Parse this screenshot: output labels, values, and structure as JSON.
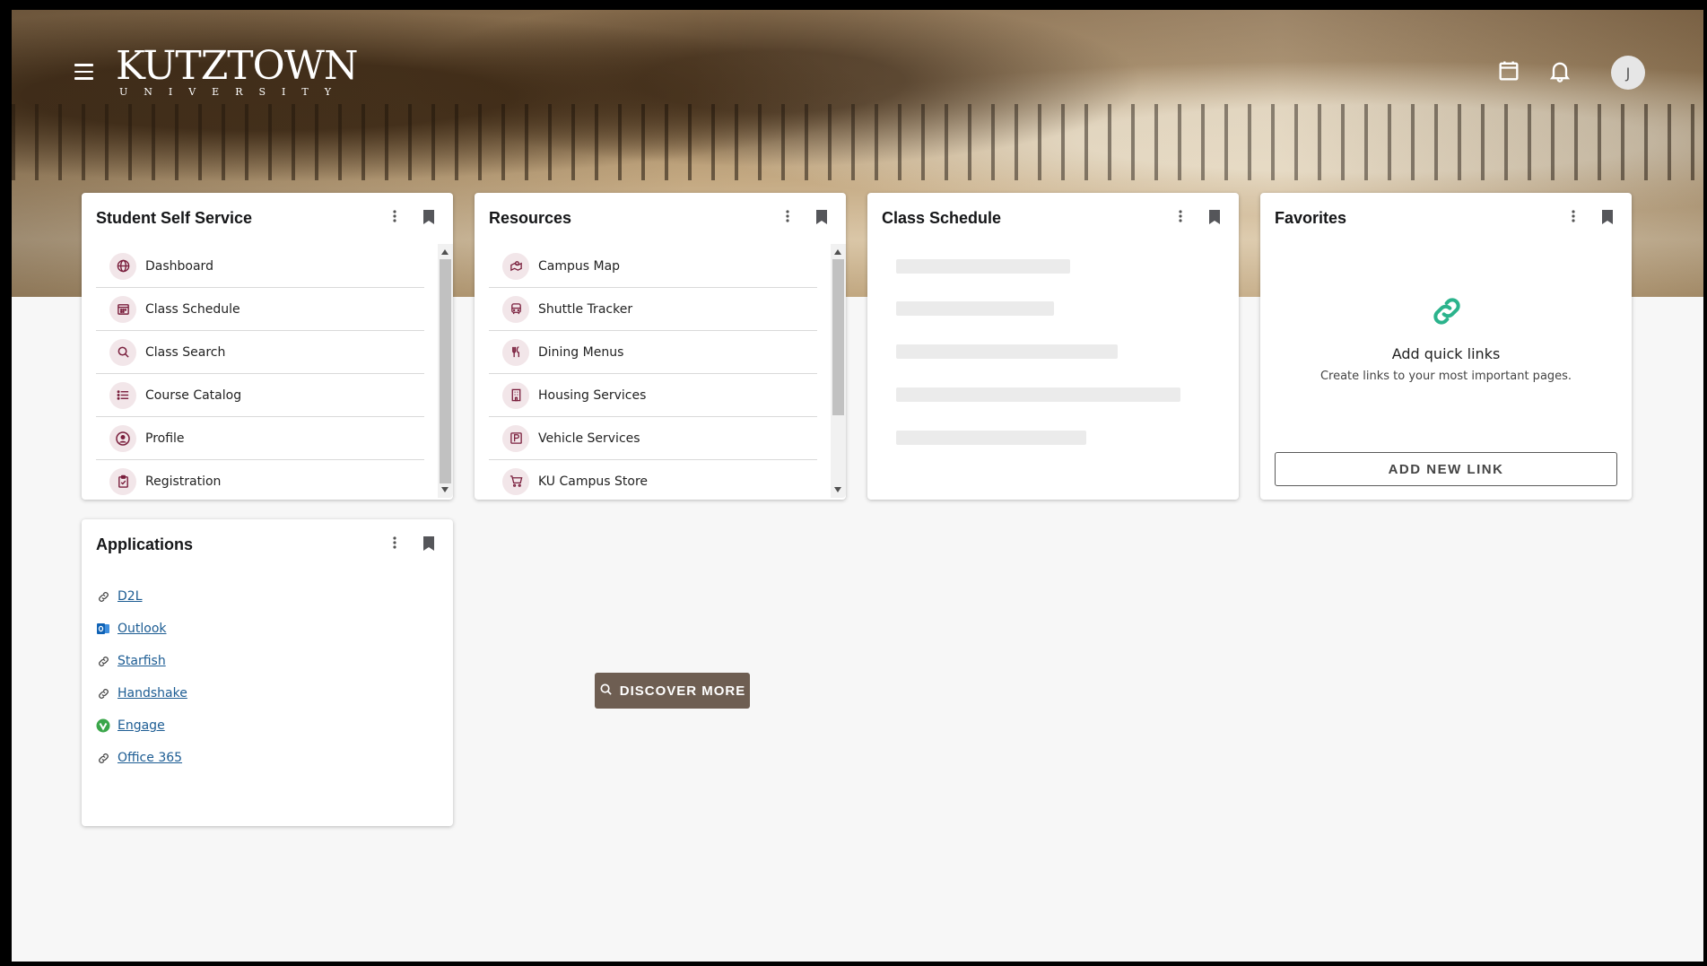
{
  "header": {
    "logo_main": "KUTZTOWN",
    "logo_sub": "UNIVERSITY",
    "avatar_initial": "J"
  },
  "cards": {
    "student_self_service": {
      "title": "Student Self Service",
      "items": [
        {
          "label": "Dashboard",
          "icon": "globe-icon"
        },
        {
          "label": "Class Schedule",
          "icon": "calendar-icon"
        },
        {
          "label": "Class Search",
          "icon": "search-icon"
        },
        {
          "label": "Course Catalog",
          "icon": "list-icon"
        },
        {
          "label": "Profile",
          "icon": "user-circle-icon"
        },
        {
          "label": "Registration",
          "icon": "clipboard-check-icon"
        }
      ]
    },
    "resources": {
      "title": "Resources",
      "items": [
        {
          "label": "Campus Map",
          "icon": "map-pin-icon"
        },
        {
          "label": "Shuttle Tracker",
          "icon": "bus-icon"
        },
        {
          "label": "Dining Menus",
          "icon": "utensils-icon"
        },
        {
          "label": "Housing Services",
          "icon": "building-icon"
        },
        {
          "label": "Vehicle Services",
          "icon": "parking-icon"
        },
        {
          "label": "KU Campus Store",
          "icon": "cart-icon"
        }
      ]
    },
    "class_schedule": {
      "title": "Class Schedule"
    },
    "favorites": {
      "title": "Favorites",
      "empty_title": "Add quick links",
      "empty_desc": "Create links to your most important pages.",
      "add_button": "ADD NEW LINK"
    },
    "applications": {
      "title": "Applications",
      "items": [
        {
          "label": "D2L",
          "icon": "link-icon"
        },
        {
          "label": "Outlook",
          "icon": "outlook-icon"
        },
        {
          "label": "Starfish",
          "icon": "link-icon"
        },
        {
          "label": "Handshake",
          "icon": "link-icon"
        },
        {
          "label": "Engage",
          "icon": "engage-icon"
        },
        {
          "label": "Office 365",
          "icon": "link-icon"
        }
      ]
    }
  },
  "discover_button": "DISCOVER MORE",
  "colors": {
    "accent_maroon": "#7a1f3d",
    "icon_bg": "#f2e6e9",
    "link_blue": "#1c5c93",
    "favorites_green": "#2bb38c",
    "discover_bg": "#6e5e52"
  }
}
